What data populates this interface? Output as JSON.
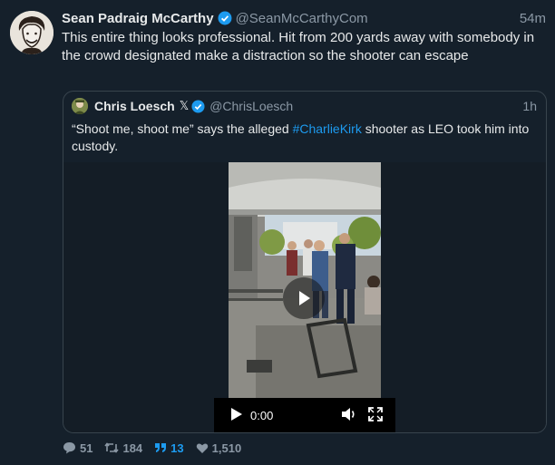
{
  "tweet": {
    "author_name": "Sean Padraig McCarthy",
    "handle": "@SeanMcCarthyCom",
    "time": "54m",
    "text": "This entire thing looks professional. Hit from 200 yards away with somebody in the crowd designated make a distraction so the shooter can escape"
  },
  "quoted": {
    "author_name": "Chris Loesch",
    "x_glyph": "𝕏",
    "handle": "@ChrisLoesch",
    "time": "1h",
    "text_before": "“Shoot me, shoot me” says the alleged ",
    "hashtag": "#CharlieKirk",
    "text_after": " shooter as LEO took him into custody.",
    "video_time": "0:00"
  },
  "stats": {
    "replies": "51",
    "retweets": "184",
    "quotes": "13",
    "likes": "1,510"
  },
  "colors": {
    "background": "#15202b",
    "accent": "#1d9bf0",
    "muted": "#8b98a5"
  }
}
